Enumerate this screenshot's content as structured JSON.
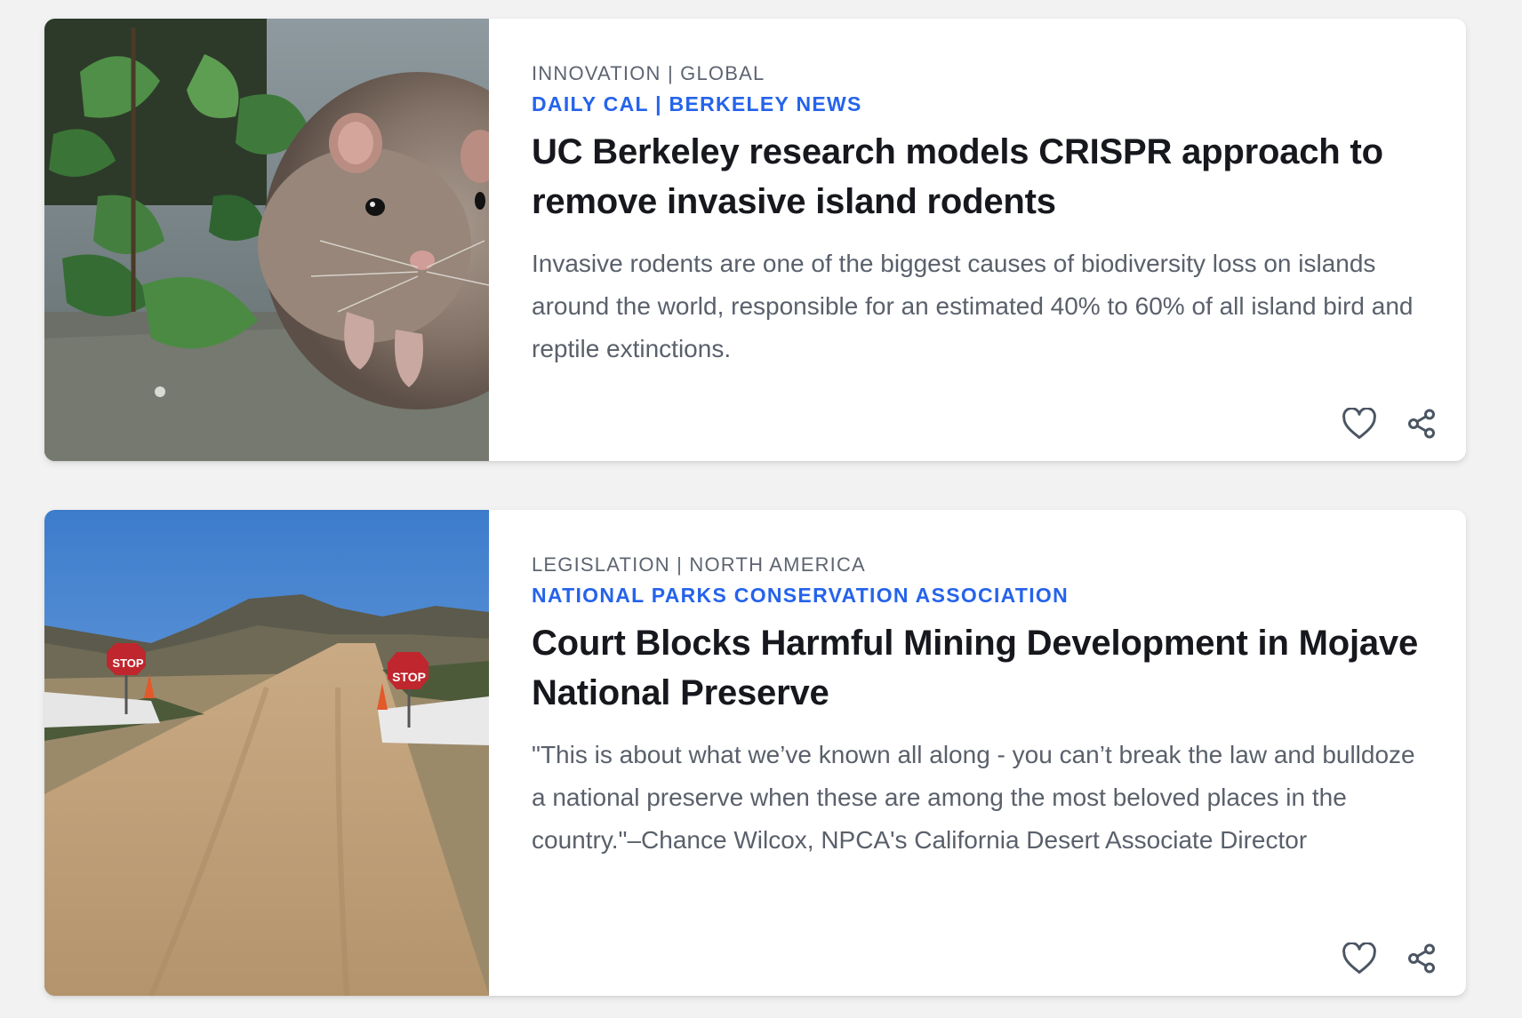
{
  "articles": [
    {
      "category": "INNOVATION | GLOBAL",
      "source": "DAILY CAL | BERKELEY NEWS",
      "title": "UC Berkeley research models CRISPR approach to remove invasive island rodents",
      "excerpt": "Invasive rodents are one of the biggest causes of biodiversity loss on islands around the world, responsible for an estimated 40% to 60% of all island bird and reptile extinctions.",
      "image": "rat-among-ivy-leaves-photo",
      "actions": {
        "like_icon": "heart-icon",
        "share_icon": "share-icon"
      }
    },
    {
      "category": "LEGISLATION | NORTH AMERICA",
      "source": "NATIONAL PARKS CONSERVATION ASSOCIATION",
      "title": "Court Blocks Harmful Mining Development in Mojave National Preserve",
      "excerpt": "\"This is about what we’ve known all along - you can’t break the law and bulldoze a national preserve when these are among the most beloved places in the country.\"–Chance Wilcox, NPCA's California Desert Associate Director",
      "image": "desert-dirt-road-with-stop-signs-photo",
      "image_text": [
        "STOP",
        "STOP"
      ],
      "actions": {
        "like_icon": "heart-icon",
        "share_icon": "share-icon"
      }
    }
  ],
  "colors": {
    "page_background": "#f2f2f3",
    "card_background": "#ffffff",
    "category_text": "#5e6470",
    "source_link": "#2563eb",
    "title_text": "#16181d",
    "excerpt_text": "#5a606b",
    "icon_stroke": "#4b5563"
  }
}
